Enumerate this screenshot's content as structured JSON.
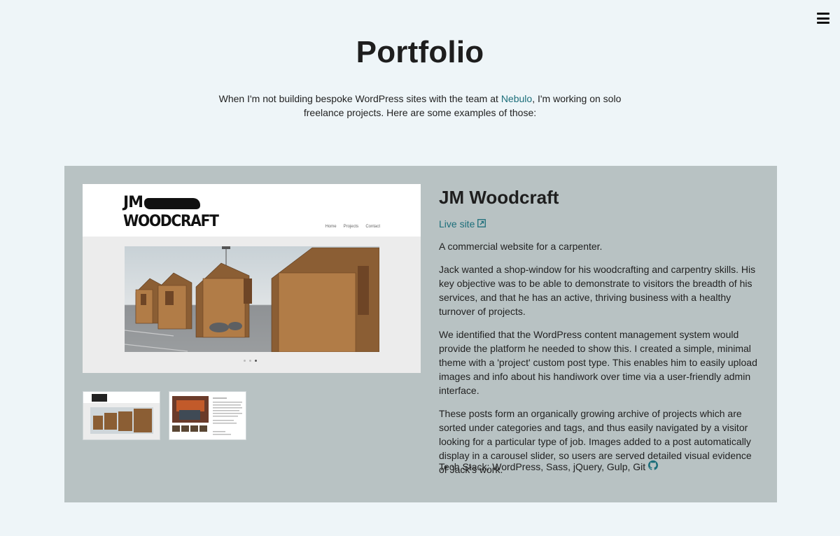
{
  "page": {
    "title": "Portfolio",
    "intro_before": "When I'm not building bespoke WordPress sites with the team at ",
    "intro_link": "Nebulo",
    "intro_after": ", I'm working on solo freelance projects. Here are some examples of those:",
    "menu_icon": "hamburger-menu-icon"
  },
  "project": {
    "title": "JM Woodcraft",
    "live_label": "Live site",
    "live_icon": "external-link-icon",
    "paragraphs": [
      "A commercial website for a carpenter.",
      "Jack wanted a shop-window for his woodcrafting and carpentry skills. His key objective was to be able to demonstrate to visitors the breadth of his services, and that he has an active, thriving business with a healthy turnover of projects.",
      "We identified that the WordPress content management system would provide the platform he needed to show this. I created a simple, minimal theme with a 'project' custom post type. This enables him to easily upload images and info about his handiwork over time via a user-friendly admin interface.",
      "These posts form an organically growing archive of projects which are sorted under categories and tags, and thus easily navigated by a visitor looking for a particular type of job. Images added to a post automatically display in a carousel slider, so users are served detailed visual evidence of Jack's work."
    ],
    "tech_label": "Tech Stack:",
    "tech_list": "WordPress, Sass, jQuery, Gulp, Git",
    "tech_icon": "github-icon",
    "screenshot": {
      "logo_line1": "JM",
      "logo_line2": "WOODCRAFT",
      "nav": [
        "Home",
        "Projects",
        "Contact"
      ]
    }
  },
  "colors": {
    "background": "#eef5f8",
    "card": "#b8c2c3",
    "link": "#1c6e7a",
    "heading": "#1e1e1e"
  }
}
